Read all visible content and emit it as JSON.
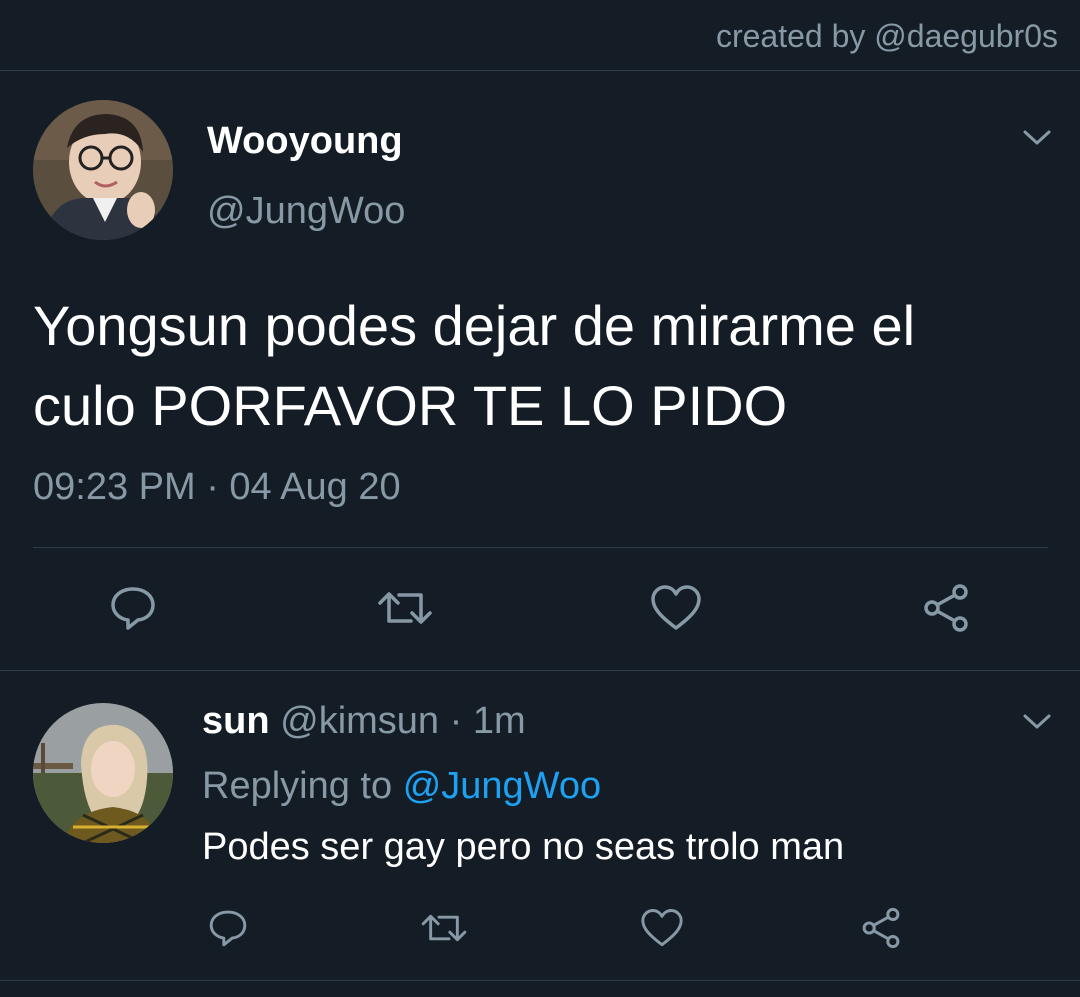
{
  "credit": "created by @daegubr0s",
  "main_tweet": {
    "display_name": "Wooyoung",
    "handle": "@JungWoo",
    "text_line1": "Yongsun podes dejar de mirarme el",
    "text_line2": "culo PORFAVOR TE LO PIDO",
    "timestamp": "09:23 PM · 04 Aug 20",
    "menu_icon": "chevron-down-icon",
    "actions": [
      "comment-icon",
      "retweet-icon",
      "heart-icon",
      "share-icon"
    ]
  },
  "reply": {
    "display_name": "sun",
    "handle_time": "@kimsun · 1m",
    "replying_label": "Replying to",
    "replying_handle": "@JungWoo",
    "text": "Podes ser gay pero no seas trolo man",
    "menu_icon": "chevron-down-icon",
    "actions": [
      "comment-icon",
      "retweet-icon",
      "heart-icon",
      "share-icon"
    ]
  },
  "colors": {
    "background": "#141d26",
    "muted_text": "#8899a6",
    "link": "#1da1f2",
    "divider": "#2f3d4a"
  }
}
